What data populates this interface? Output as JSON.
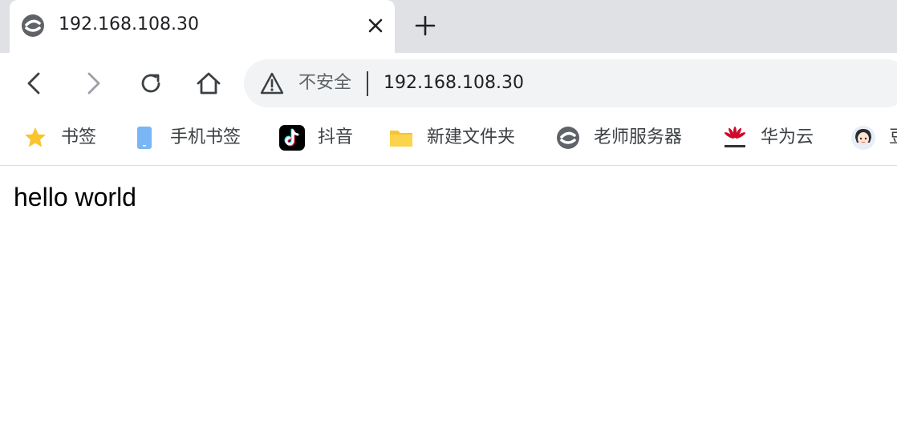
{
  "tab": {
    "title": "192.168.108.30",
    "favicon": "edge-like-site-icon"
  },
  "toolbar": {
    "back": "back-arrow-icon",
    "forward": "forward-arrow-icon",
    "reload": "reload-icon",
    "home": "home-icon"
  },
  "omnibox": {
    "security_label": "不安全",
    "url": "192.168.108.30"
  },
  "bookmarks": [
    {
      "label": "书签",
      "icon": "star-icon"
    },
    {
      "label": "手机书签",
      "icon": "phone-icon"
    },
    {
      "label": "抖音",
      "icon": "tiktok-icon"
    },
    {
      "label": "新建文件夹",
      "icon": "folder-icon"
    },
    {
      "label": "老师服务器",
      "icon": "site-icon"
    },
    {
      "label": "华为云",
      "icon": "huawei-icon"
    },
    {
      "label": "豆",
      "icon": "avatar-icon"
    }
  ],
  "page": {
    "text": "hello world"
  },
  "colors": {
    "tab_strip": "#dfe1e5",
    "omnibox_bg": "#f1f3f4",
    "star": "#f9c42e",
    "phone": "#7ab6f5",
    "folder": "#f6c531",
    "huawei": "#cf0a2c"
  }
}
